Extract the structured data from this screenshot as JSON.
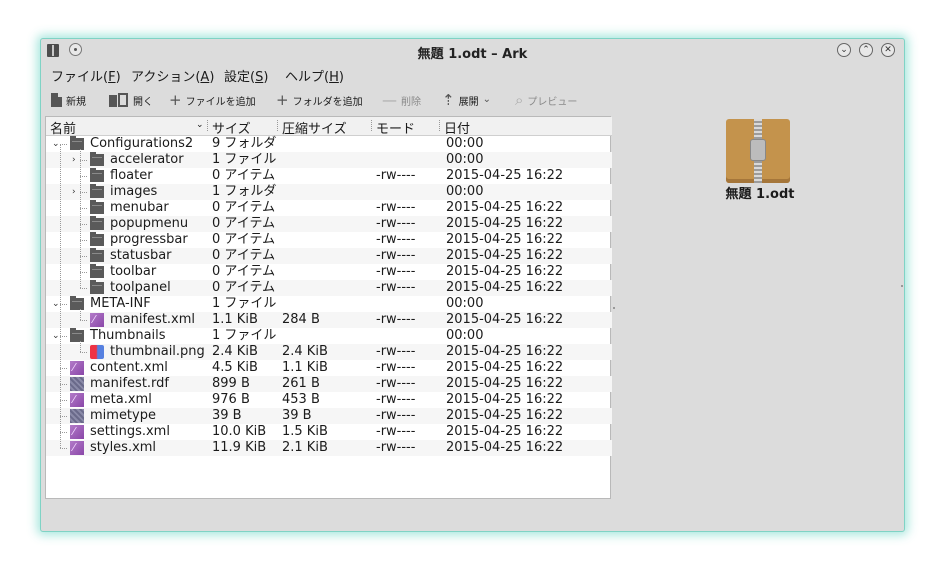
{
  "window": {
    "title": "無題 1.odt – Ark",
    "controls": {
      "minimize": "⌄",
      "maximize": "⌃",
      "close": "✕"
    }
  },
  "menubar": [
    {
      "label": "ファイル(",
      "key": "F",
      "suffix": ")"
    },
    {
      "label": "アクション(",
      "key": "A",
      "suffix": ")"
    },
    {
      "label": "設定(",
      "key": "S",
      "suffix": ")"
    },
    {
      "label": "ヘルプ(",
      "key": "H",
      "suffix": ")"
    }
  ],
  "toolbar": {
    "new": "新規",
    "open": "開く",
    "add_files": "ファイルを追加",
    "add_folder": "フォルダを追加",
    "delete": "削除",
    "extract": "展開",
    "preview": "プレビュー"
  },
  "columns": {
    "name": "名前",
    "size": "サイズ",
    "compressed": "圧縮サイズ",
    "mode": "モード",
    "date": "日付"
  },
  "rows": [
    {
      "name": "Configurations2",
      "size": "9 フォルダ",
      "compressed": "",
      "mode": "",
      "date": "00:00",
      "type": "folder",
      "depth": 0,
      "expander": "open"
    },
    {
      "name": "accelerator",
      "size": "1 ファイル",
      "compressed": "",
      "mode": "",
      "date": "00:00",
      "type": "folder",
      "depth": 1,
      "expander": "closed"
    },
    {
      "name": "floater",
      "size": "0 アイテム",
      "compressed": "",
      "mode": "-rw----",
      "date": "2015-04-25 16:22",
      "type": "folder",
      "depth": 1,
      "expander": ""
    },
    {
      "name": "images",
      "size": "1 フォルダ",
      "compressed": "",
      "mode": "",
      "date": "00:00",
      "type": "folder",
      "depth": 1,
      "expander": "closed"
    },
    {
      "name": "menubar",
      "size": "0 アイテム",
      "compressed": "",
      "mode": "-rw----",
      "date": "2015-04-25 16:22",
      "type": "folder",
      "depth": 1,
      "expander": ""
    },
    {
      "name": "popupmenu",
      "size": "0 アイテム",
      "compressed": "",
      "mode": "-rw----",
      "date": "2015-04-25 16:22",
      "type": "folder",
      "depth": 1,
      "expander": ""
    },
    {
      "name": "progressbar",
      "size": "0 アイテム",
      "compressed": "",
      "mode": "-rw----",
      "date": "2015-04-25 16:22",
      "type": "folder",
      "depth": 1,
      "expander": ""
    },
    {
      "name": "statusbar",
      "size": "0 アイテム",
      "compressed": "",
      "mode": "-rw----",
      "date": "2015-04-25 16:22",
      "type": "folder",
      "depth": 1,
      "expander": ""
    },
    {
      "name": "toolbar",
      "size": "0 アイテム",
      "compressed": "",
      "mode": "-rw----",
      "date": "2015-04-25 16:22",
      "type": "folder",
      "depth": 1,
      "expander": ""
    },
    {
      "name": "toolpanel",
      "size": "0 アイテム",
      "compressed": "",
      "mode": "-rw----",
      "date": "2015-04-25 16:22",
      "type": "folder",
      "depth": 1,
      "expander": ""
    },
    {
      "name": "META-INF",
      "size": "1 ファイル",
      "compressed": "",
      "mode": "",
      "date": "00:00",
      "type": "folder",
      "depth": 0,
      "expander": "open"
    },
    {
      "name": "manifest.xml",
      "size": "1.1 KiB",
      "compressed": "284 B",
      "mode": "-rw----",
      "date": "2015-04-25 16:22",
      "type": "xml",
      "depth": 1,
      "expander": ""
    },
    {
      "name": "Thumbnails",
      "size": "1 ファイル",
      "compressed": "",
      "mode": "",
      "date": "00:00",
      "type": "folder",
      "depth": 0,
      "expander": "open"
    },
    {
      "name": "thumbnail.png",
      "size": "2.4 KiB",
      "compressed": "2.4 KiB",
      "mode": "-rw----",
      "date": "2015-04-25 16:22",
      "type": "png",
      "depth": 1,
      "expander": ""
    },
    {
      "name": "content.xml",
      "size": "4.5 KiB",
      "compressed": "1.1 KiB",
      "mode": "-rw----",
      "date": "2015-04-25 16:22",
      "type": "xml",
      "depth": 0,
      "expander": ""
    },
    {
      "name": "manifest.rdf",
      "size": "899 B",
      "compressed": "261 B",
      "mode": "-rw----",
      "date": "2015-04-25 16:22",
      "type": "rdf",
      "depth": 0,
      "expander": ""
    },
    {
      "name": "meta.xml",
      "size": "976 B",
      "compressed": "453 B",
      "mode": "-rw----",
      "date": "2015-04-25 16:22",
      "type": "xml",
      "depth": 0,
      "expander": ""
    },
    {
      "name": "mimetype",
      "size": "39 B",
      "compressed": "39 B",
      "mode": "-rw----",
      "date": "2015-04-25 16:22",
      "type": "rdf",
      "depth": 0,
      "expander": ""
    },
    {
      "name": "settings.xml",
      "size": "10.0 KiB",
      "compressed": "1.5 KiB",
      "mode": "-rw----",
      "date": "2015-04-25 16:22",
      "type": "xml",
      "depth": 0,
      "expander": ""
    },
    {
      "name": "styles.xml",
      "size": "11.9 KiB",
      "compressed": "2.1 KiB",
      "mode": "-rw----",
      "date": "2015-04-25 16:22",
      "type": "xml",
      "depth": 0,
      "expander": ""
    }
  ],
  "preview": {
    "filename": "無題 1.odt",
    "icon": "zip-archive-icon"
  }
}
